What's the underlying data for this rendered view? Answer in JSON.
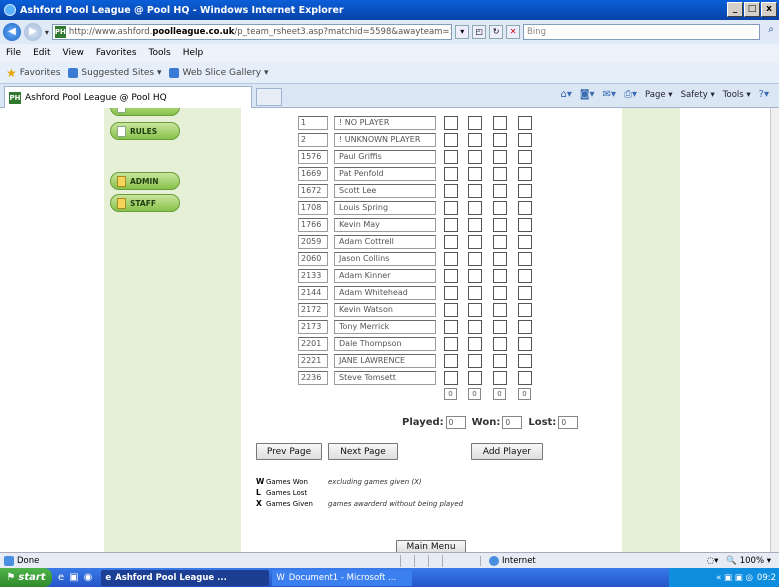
{
  "window": {
    "title": "Ashford Pool League @ Pool HQ - Windows Internet Explorer"
  },
  "address": {
    "url_prefix": "http://www.ashford.",
    "url_bold": "poolleague.co.uk",
    "url_suffix": "/p_team_rsheet3.asp?matchid=5598&awayteam=1&x=0",
    "search_placeholder": "Bing"
  },
  "menu": [
    "File",
    "Edit",
    "View",
    "Favorites",
    "Tools",
    "Help"
  ],
  "favorites": {
    "label": "Favorites",
    "suggested": "Suggested Sites ▾",
    "webslice": "Web Slice Gallery ▾"
  },
  "tab": {
    "title": "Ashford Pool League @ Pool HQ"
  },
  "commandbar": [
    "Page ▾",
    "Safety ▾",
    "Tools ▾"
  ],
  "sidebar": {
    "rules": "RULES",
    "admin": "ADMIN",
    "staff": "STAFF"
  },
  "players": [
    {
      "id": "1",
      "name": "! NO PLAYER"
    },
    {
      "id": "2",
      "name": "! UNKNOWN PLAYER"
    },
    {
      "id": "1576",
      "name": "Paul Griffis"
    },
    {
      "id": "1669",
      "name": "Pat Penfold"
    },
    {
      "id": "1672",
      "name": "Scott Lee"
    },
    {
      "id": "1708",
      "name": "Louis Spring"
    },
    {
      "id": "1766",
      "name": "Kevin May"
    },
    {
      "id": "2059",
      "name": "Adam Cottrell"
    },
    {
      "id": "2060",
      "name": "Jason Collins"
    },
    {
      "id": "2133",
      "name": "Adam  Kinner"
    },
    {
      "id": "2144",
      "name": "Adam Whitehead"
    },
    {
      "id": "2172",
      "name": "Kevin Watson"
    },
    {
      "id": "2173",
      "name": "Tony Merrick"
    },
    {
      "id": "2201",
      "name": "Dale Thompson"
    },
    {
      "id": "2221",
      "name": "JANE  LAWRENCE"
    },
    {
      "id": "2236",
      "name": "Steve Tomsett"
    }
  ],
  "totals": [
    "0",
    "0",
    "0",
    "0"
  ],
  "stats": {
    "played_label": "Played:",
    "played": "0",
    "won_label": "Won:",
    "won": "0",
    "lost_label": "Lost:",
    "lost": "0"
  },
  "buttons": {
    "prev": "Prev Page",
    "next": "Next Page",
    "add": "Add Player",
    "main_menu": "Main Menu"
  },
  "legend": [
    {
      "key": "W",
      "label": "Games Won",
      "note": "excluding games given (X)"
    },
    {
      "key": "L",
      "label": "Games Lost",
      "note": ""
    },
    {
      "key": "X",
      "label": "Games Given",
      "note": "games awarderd without being played"
    }
  ],
  "status": {
    "text": "Done",
    "zone": "Internet",
    "zoom": "100%"
  },
  "taskbar": {
    "start": "start",
    "active_task": "Ashford Pool League ...",
    "other_task": "Document1 - Microsoft ...",
    "clock": "09:2"
  }
}
